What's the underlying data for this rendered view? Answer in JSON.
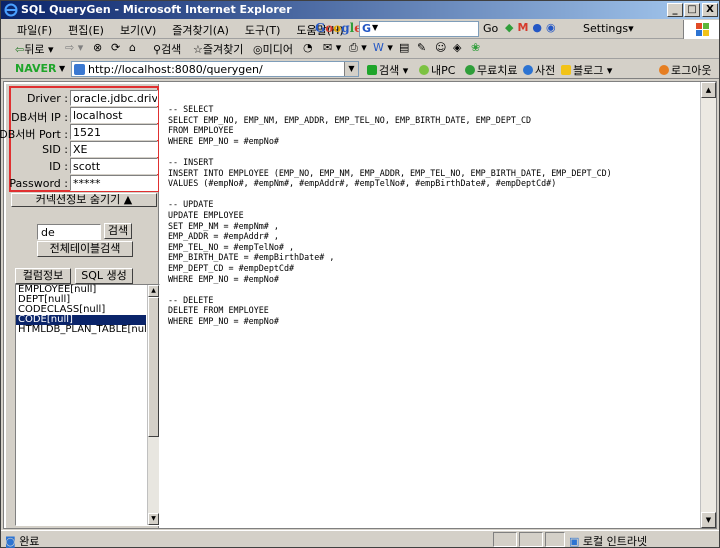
{
  "window": {
    "title": "SQL QueryGen - Microsoft Internet Explorer",
    "minimize_label": "_",
    "maximize_label": "□",
    "close_label": "X"
  },
  "menubar": {
    "items": [
      "파일(F)",
      "편집(E)",
      "보기(V)",
      "즐겨찾기(A)",
      "도구(T)",
      "도움말(H)"
    ]
  },
  "google_bar": {
    "logo": "Google",
    "go_label": "Go",
    "settings_label": "Settings▾"
  },
  "toolbar": {
    "back_label": "뒤로",
    "search_label": "검색",
    "favorites_label": "즐겨찾기",
    "media_label": "미디어"
  },
  "address_bar": {
    "naver_label": "NAVER",
    "url": "http://localhost:8080/querygen/",
    "search_label": "검색",
    "mypc_label": "내PC",
    "free_treat_label": "무료치료",
    "dictionary_label": "사전",
    "blog_label": "블로그",
    "logout_label": "로그아웃"
  },
  "connection": {
    "fields": [
      {
        "label": "Driver :",
        "value": "oracle.jdbc.driver.C"
      },
      {
        "label": "DB서버 IP :",
        "value": "localhost"
      },
      {
        "label": "DB서버 Port :",
        "value": "1521"
      },
      {
        "label": "SID :",
        "value": "XE"
      },
      {
        "label": "ID :",
        "value": "scott"
      },
      {
        "label": "Password :",
        "value": "*****"
      }
    ],
    "toggle_label": "커넥션정보 숨기기 ▲"
  },
  "table_search": {
    "value": "de",
    "search_button": "검색",
    "show_all_button": "전체테이블검색"
  },
  "actions": {
    "column_info_button": "컬럼정보",
    "sql_generate_button": "SQL 생성"
  },
  "tables": [
    {
      "name": "EMPLOYEE[null]",
      "selected": false
    },
    {
      "name": "DEPT[null]",
      "selected": false
    },
    {
      "name": "CODECLASS[null]",
      "selected": false
    },
    {
      "name": "CODE[null]",
      "selected": true
    },
    {
      "name": "HTMLDB_PLAN_TABLE[null]",
      "selected": false
    }
  ],
  "sql_output": "-- SELECT\nSELECT EMP_NO, EMP_NM, EMP_ADDR, EMP_TEL_NO, EMP_BIRTH_DATE, EMP_DEPT_CD\nFROM EMPLOYEE\nWHERE EMP_NO = #empNo#\n\n-- INSERT\nINSERT INTO EMPLOYEE (EMP_NO, EMP_NM, EMP_ADDR, EMP_TEL_NO, EMP_BIRTH_DATE, EMP_DEPT_CD)\nVALUES (#empNo#, #empNm#, #empAddr#, #empTelNo#, #empBirthDate#, #empDeptCd#)\n\n-- UPDATE\nUPDATE EMPLOYEE\nSET EMP_NM = #empNm# ,\nEMP_ADDR = #empAddr# ,\nEMP_TEL_NO = #empTelNo# ,\nEMP_BIRTH_DATE = #empBirthDate# ,\nEMP_DEPT_CD = #empDeptCd#\nWHERE EMP_NO = #empNo#\n\n-- DELETE\nDELETE FROM EMPLOYEE\nWHERE EMP_NO = #empNo#",
  "statusbar": {
    "done_label": "완료",
    "zone_label": "로컬 인트라넷"
  },
  "colors": {
    "highlight_border": "#e03030",
    "selection": "#0a246a",
    "naver_green": "#1fa52a"
  }
}
